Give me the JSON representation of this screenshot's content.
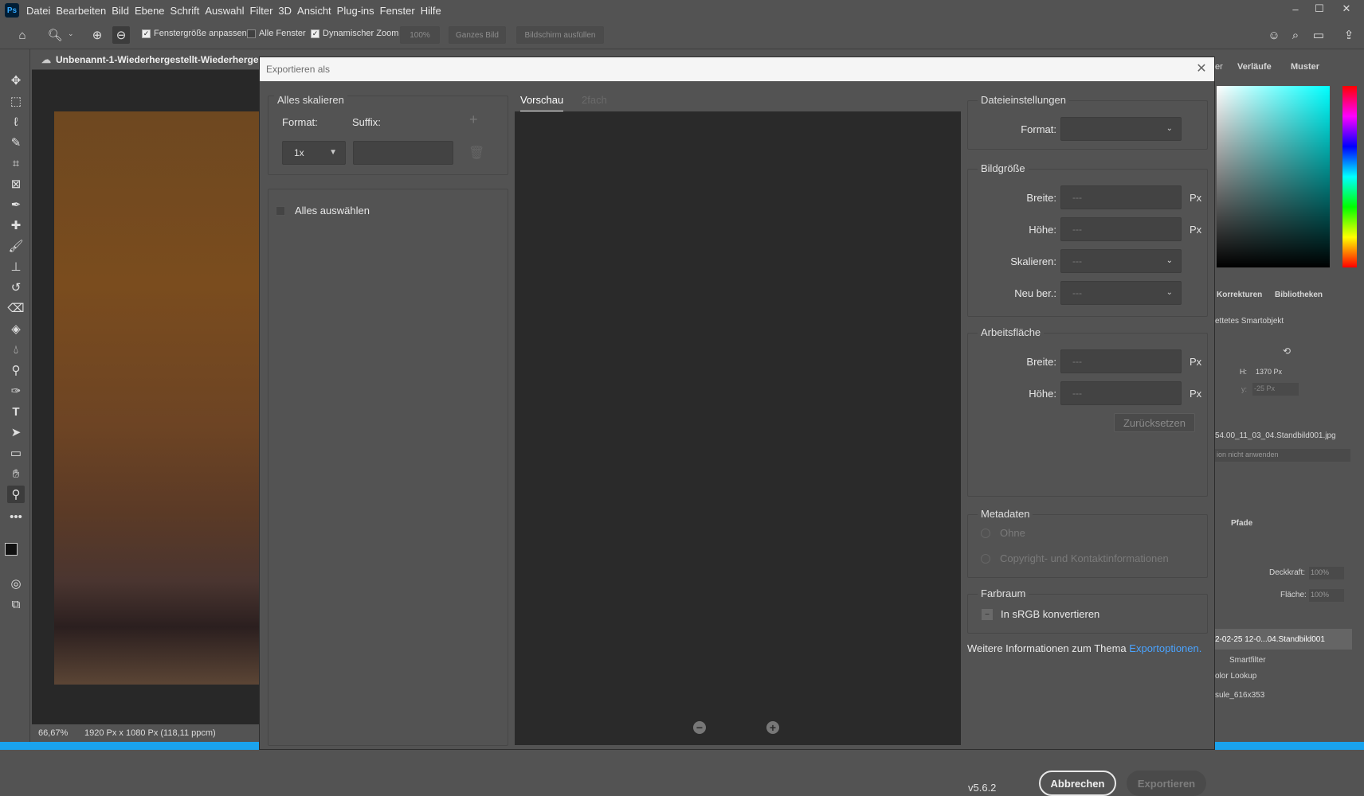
{
  "app": {
    "logo": "Ps",
    "menu": [
      "Datei",
      "Bearbeiten",
      "Bild",
      "Ebene",
      "Schrift",
      "Auswahl",
      "Filter",
      "3D",
      "Ansicht",
      "Plug-ins",
      "Fenster",
      "Hilfe"
    ]
  },
  "options": {
    "fit_window": "Fenstergröße anpassen",
    "all_windows": "Alle Fenster",
    "dynamic_zoom": "Dynamischer Zoom",
    "zoom_value": "100%",
    "whole_image": "Ganzes Bild",
    "fill_screen": "Bildschirm ausfüllen"
  },
  "document": {
    "tab_title": "Unbenannt-1-Wiederhergestellt-Wiederhergestellt",
    "zoom": "66,67%",
    "info": "1920 Px x 1080 Px (118,11 ppcm)"
  },
  "panels": {
    "tab_gradients": "Verläufe",
    "tab_swatches": "Muster",
    "tab_partial": "er",
    "tab_corrections": "Korrekturen",
    "tab_libraries": "Bibliotheken",
    "smart_object": "ettetes Smartobjekt",
    "h_label": "H:",
    "h_value": "1370 Px",
    "y_label": "y:",
    "y_value": "-25 Px",
    "file_name": "54.00_11_03_04.Standbild001.jpg",
    "apply_option": "ion nicht anwenden",
    "tab_paths": "Pfade",
    "opacity_label": "Deckkraft:",
    "opacity_value": "100%",
    "fill_label": "Fläche:",
    "fill_value": "100%",
    "layer_name": "2-02-25 12-0...04.Standbild001",
    "smartfilter": "Smartfilter",
    "color_lookup": "olor Lookup",
    "layer2": "sule_616x353"
  },
  "dialog": {
    "title": "Exportieren als",
    "scale": {
      "legend": "Alles skalieren",
      "format_label": "Format:",
      "suffix_label": "Suffix:",
      "scale_value": "1x",
      "select_all": "Alles auswählen"
    },
    "preview_tabs": [
      "Vorschau",
      "2fach"
    ],
    "file": {
      "legend": "Dateieinstellungen",
      "format_label": "Format:"
    },
    "image_size": {
      "legend": "Bildgröße",
      "width_label": "Breite:",
      "height_label": "Höhe:",
      "scale_label": "Skalieren:",
      "resample_label": "Neu ber.:",
      "placeholder": "---",
      "unit": "Px"
    },
    "canvas": {
      "legend": "Arbeitsfläche",
      "width_label": "Breite:",
      "height_label": "Höhe:",
      "reset": "Zurücksetzen"
    },
    "metadata": {
      "legend": "Metadaten",
      "none": "Ohne",
      "copyright": "Copyright- und Kontaktinformationen"
    },
    "colorspace": {
      "legend": "Farbraum",
      "srgb": "In sRGB konvertieren"
    },
    "more_info": "Weitere Informationen zum Thema",
    "export_options_link": "Exportoptionen.",
    "version": "v5.6.2",
    "cancel": "Abbrechen",
    "export": "Exportieren"
  },
  "colors": {
    "accent": "#4aa3ff",
    "taskbar": "#1aa3ee"
  }
}
